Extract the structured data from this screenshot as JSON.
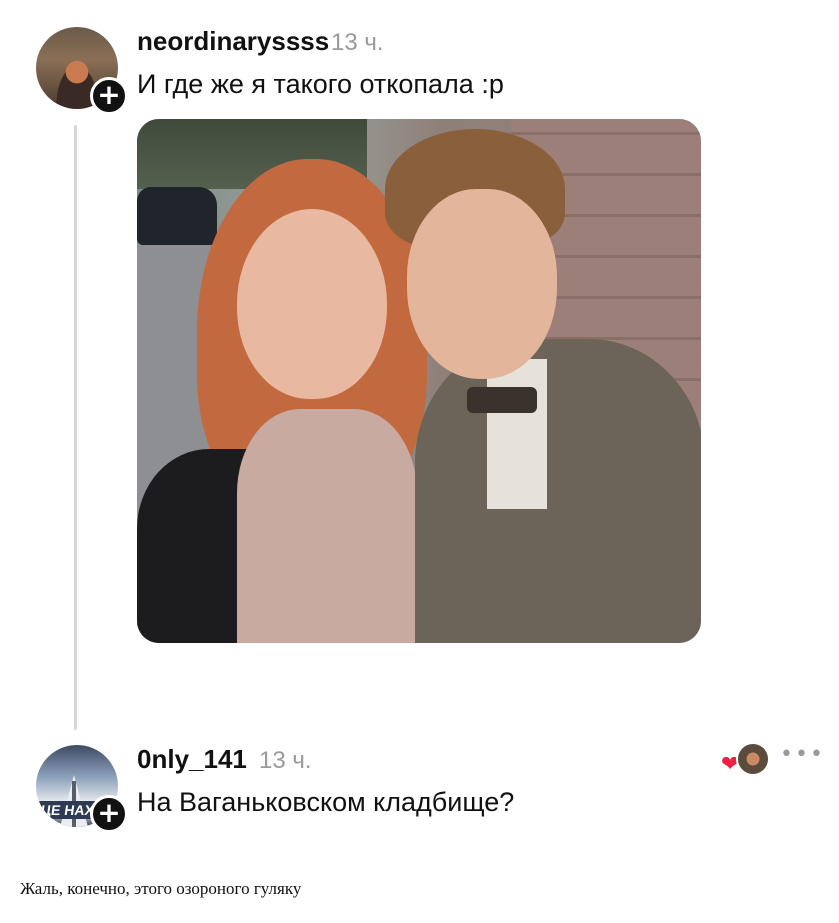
{
  "comments": [
    {
      "username": "neordinaryssss",
      "time": "13 ч.",
      "text": "И где же я такого откопала :р",
      "follow_icon": "plus-icon",
      "follow_symbol": "+"
    },
    {
      "username": "0nly_141",
      "time": "13 ч.",
      "text": "На Ваганьковском кладбище?",
      "follow_icon": "plus-icon",
      "follow_symbol": "+",
      "avatar_text": "ЦЕ НАХ",
      "reaction_icon": "heart-icon",
      "reaction_symbol": "❤",
      "more_icon": "more-options-icon",
      "more_symbol": "•••"
    }
  ],
  "caption": "Жаль, конечно, этого озороного гуляку",
  "colors": {
    "text": "#111111",
    "muted": "#9a9a9a",
    "heart": "#ef1f44",
    "thread_line": "#d6d6d6"
  }
}
